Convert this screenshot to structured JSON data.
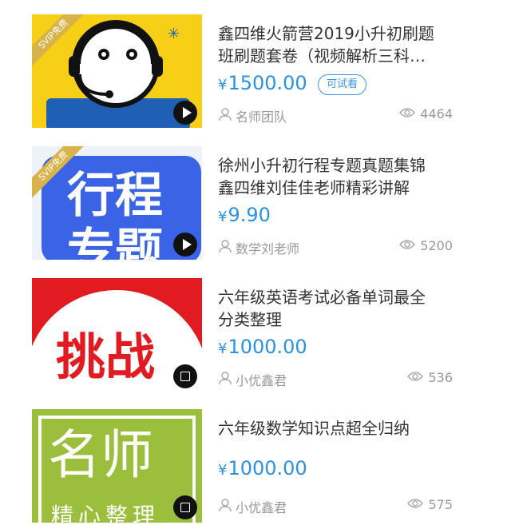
{
  "items": [
    {
      "title_line1": "鑫四维火箭营2019小升初刷题",
      "title_line2": "班刷题套卷（视频解析三科…",
      "price_symbol": "¥",
      "price": "1500.00",
      "trial_label": "可试看",
      "author": "名师团队",
      "views": "4464",
      "svip": "SVIP免费",
      "thumb_text": "",
      "media": "video"
    },
    {
      "title_line1": "徐州小升初行程专题真题集锦",
      "title_line2": "鑫四维刘佳佳老师精彩讲解",
      "price_symbol": "¥",
      "price": "9.90",
      "author": "数学刘老师",
      "views": "5200",
      "svip": "SVIP免费",
      "thumb_text": "行程",
      "thumb_text2": "专题",
      "media": "video"
    },
    {
      "title_line1": "六年级英语考试必备单词最全",
      "title_line2": "分类整理",
      "price_symbol": "¥",
      "price": "1000.00",
      "author": "小优鑫君",
      "views": "536",
      "thumb_text": "挑战",
      "media": "doc"
    },
    {
      "title_line1": "六年级数学知识点超全归纳",
      "title_line2": "",
      "price_symbol": "¥",
      "price": "1000.00",
      "author": "小优鑫君",
      "views": "575",
      "thumb_text": "名师",
      "thumb_text2": "精心整理",
      "media": "doc"
    }
  ]
}
